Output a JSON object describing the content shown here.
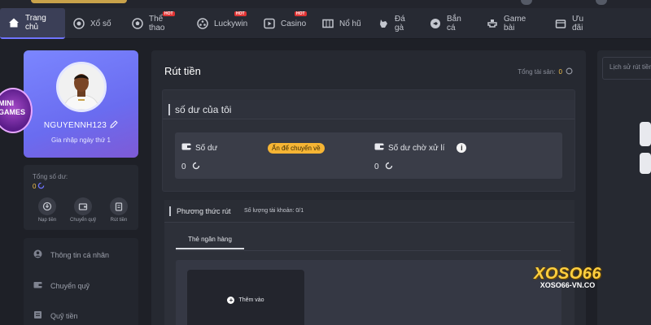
{
  "nav": {
    "items": [
      {
        "label": "Trang chủ",
        "icon": "home-icon",
        "active": true
      },
      {
        "label": "Xổ số",
        "icon": "lottery-icon"
      },
      {
        "label": "Thể thao",
        "icon": "soccer-icon",
        "hot": "HOT"
      },
      {
        "label": "Luckywin",
        "icon": "luckywin-icon",
        "hot": "HOT"
      },
      {
        "label": "Casino",
        "icon": "casino-icon",
        "hot": "HOT"
      },
      {
        "label": "Nổ hũ",
        "icon": "slot-icon"
      },
      {
        "label": "Đá gà",
        "icon": "rooster-icon"
      },
      {
        "label": "Bắn cá",
        "icon": "fish-icon"
      },
      {
        "label": "Game bài",
        "icon": "cards-icon"
      },
      {
        "label": "Ưu đãi",
        "icon": "gift-icon"
      }
    ]
  },
  "profile": {
    "username": "NGUYENNH123",
    "joined": "Gia nhập ngày thứ 1"
  },
  "badge": {
    "text": "MINI GAMES"
  },
  "wallet": {
    "label": "Tổng số dư:",
    "value": "0",
    "actions": [
      {
        "label": "Nạp tiền",
        "icon": "deposit-icon"
      },
      {
        "label": "Chuyển quỹ",
        "icon": "transfer-icon"
      },
      {
        "label": "Rút tiền",
        "icon": "withdraw-icon"
      }
    ]
  },
  "side_menu": [
    {
      "label": "Thông tin cá nhân",
      "icon": "user-icon"
    },
    {
      "label": "Chuyển quỹ",
      "icon": "wallet-icon"
    },
    {
      "label": "Quỹ tiền",
      "icon": "fund-icon"
    }
  ],
  "main": {
    "title": "Rút tiền",
    "assets_label": "Tổng tài sản:",
    "assets_value": "0",
    "balance_heading": "số dư của tôi",
    "balance_label": "Số dư",
    "hide_pill": "Ấn để chuyển về",
    "balance_value": "0",
    "pending_label": "Số dư chờ xử lí",
    "pending_value": "0",
    "method_heading": "Phương thức rút",
    "account_count": "Số lượng tài khoản:  0/1",
    "tab_bank": "Thẻ ngân hàng",
    "add_label": "Thêm vào"
  },
  "right": {
    "history_label": "Lịch sử rút tiền"
  },
  "logo": {
    "name": "XOSO66",
    "domain": "XOSO66-VN.CO"
  },
  "colors": {
    "accent": "#6f74ff",
    "gold": "#f5c24a",
    "pill": "#f6b534"
  }
}
